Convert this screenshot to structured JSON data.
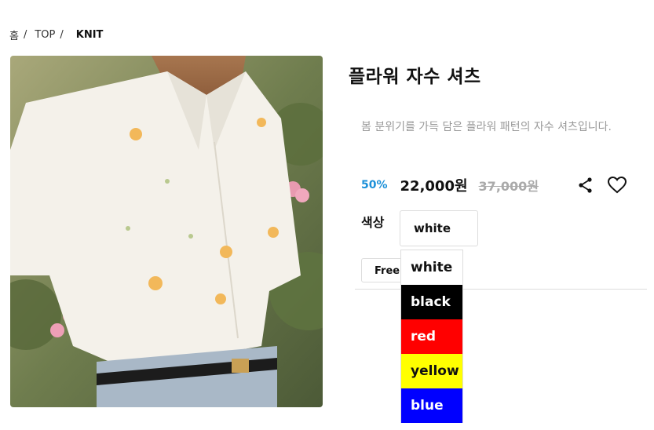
{
  "breadcrumb": {
    "home": "홈",
    "category": "TOP",
    "current": "KNIT",
    "sep": "/"
  },
  "product": {
    "title": "플라워 자수 셔츠",
    "description": "봄 분위기를 가득 담은 플라워 패턴의 자수 셔츠입니다.",
    "discount": "50%",
    "price": "22,000원",
    "original_price": "37,000원"
  },
  "icons": {
    "share": "share-icon",
    "like": "heart-icon"
  },
  "options": {
    "color_label": "색상",
    "selected_color": "white",
    "size_label": "Free",
    "color_options": [
      {
        "label": "white",
        "bg": "#ffffff",
        "fg": "#111111"
      },
      {
        "label": "black",
        "bg": "#000000",
        "fg": "#ffffff"
      },
      {
        "label": "red",
        "bg": "#ff0000",
        "fg": "#ffffff"
      },
      {
        "label": "yellow",
        "bg": "#ffff00",
        "fg": "#111111"
      },
      {
        "label": "blue",
        "bg": "#0000ff",
        "fg": "#ffffff"
      }
    ]
  },
  "colors": {
    "discount": "#1a8fd8",
    "muted": "#999999"
  }
}
